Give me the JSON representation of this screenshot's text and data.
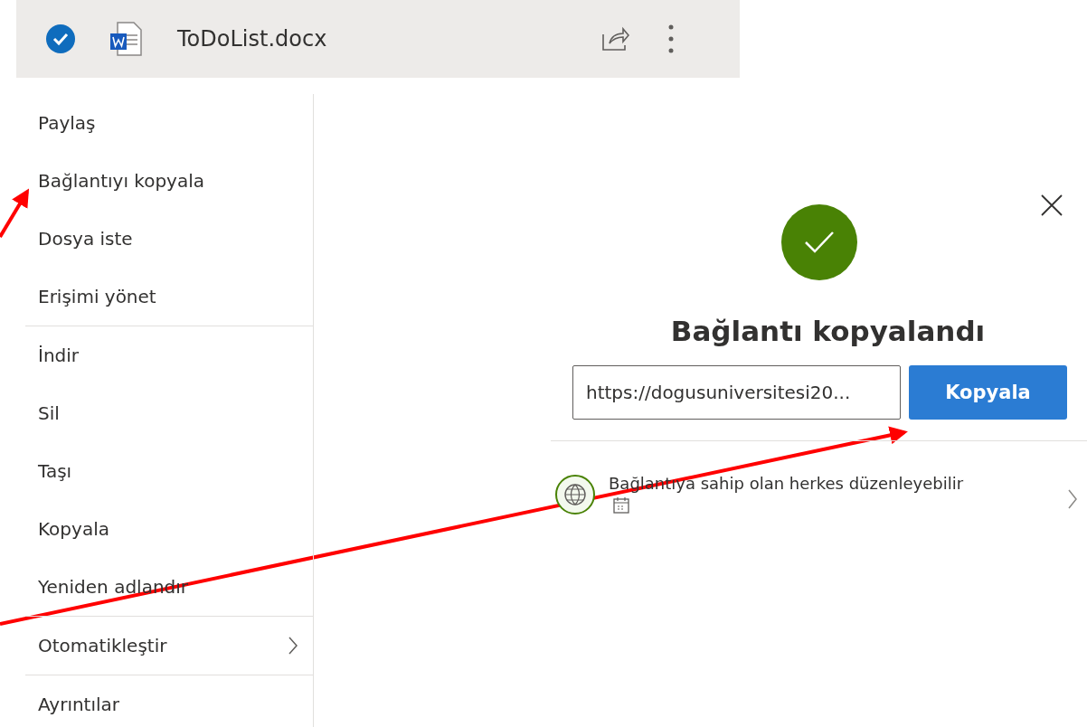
{
  "header": {
    "file_name": "ToDoList.docx",
    "selected": true
  },
  "menu": {
    "groups": [
      [
        {
          "label": "Paylaş",
          "submenu": false
        },
        {
          "label": "Bağlantıyı kopyala",
          "submenu": false
        },
        {
          "label": "Dosya iste",
          "submenu": false
        },
        {
          "label": "Erişimi yönet",
          "submenu": false
        }
      ],
      [
        {
          "label": "İndir",
          "submenu": false
        },
        {
          "label": "Sil",
          "submenu": false
        },
        {
          "label": "Taşı",
          "submenu": false
        },
        {
          "label": "Kopyala",
          "submenu": false
        },
        {
          "label": "Yeniden adlandır",
          "submenu": false
        }
      ],
      [
        {
          "label": "Otomatikleştir",
          "submenu": true
        }
      ],
      [
        {
          "label": "Ayrıntılar",
          "submenu": false
        }
      ]
    ]
  },
  "dialog": {
    "title": "Bağlantı kopyalandı",
    "link_value": "https://dogusuniversitesi20...",
    "copy_button": "Kopyala",
    "permission": "Bağlantıya sahip olan herkes düzenleyebilir"
  }
}
